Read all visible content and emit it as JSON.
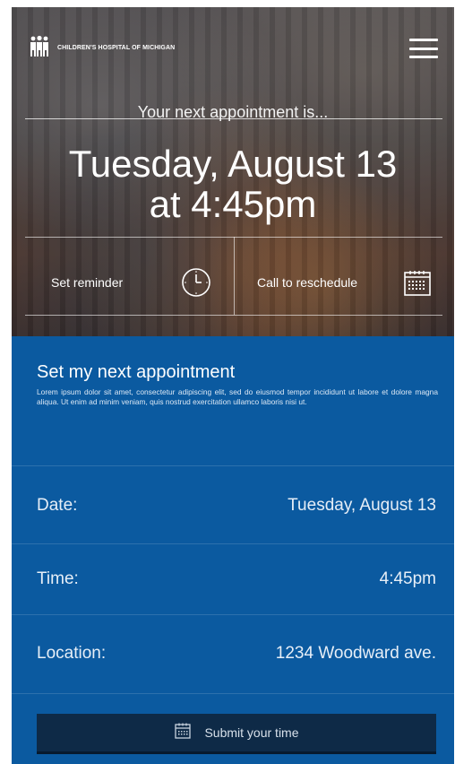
{
  "header": {
    "logo_text": "CHILDREN'S HOSPITAL OF MICHIGAN",
    "logo_icon": "family-icon",
    "menu_icon": "hamburger-menu-icon"
  },
  "hero": {
    "intro": "Your next appointment is...",
    "date": "Tuesday, August 13",
    "time": "at 4:45pm",
    "actions": {
      "reminder_label": "Set reminder",
      "reminder_icon": "clock-icon",
      "reschedule_label": "Call to reschedule",
      "reschedule_icon": "calendar-icon"
    }
  },
  "form": {
    "title": "Set my next appointment",
    "description": "Lorem ipsum dolor sit amet, consectetur adipiscing elit, sed do eiusmod tempor incididunt ut labore et dolore magna aliqua. Ut enim ad minim veniam, quis nostrud exercitation ullamco laboris nisi ut.",
    "fields": [
      {
        "label": "Date:",
        "value": "Tuesday, August 13"
      },
      {
        "label": "Time:",
        "value": "4:45pm"
      },
      {
        "label": "Location:",
        "value": "1234 Woodward ave."
      }
    ],
    "submit_label": "Submit your time",
    "submit_icon": "calendar-icon"
  },
  "colors": {
    "primary_blue": "#0b5aa0",
    "button_navy": "#0e2a47",
    "text_white": "#ffffff"
  }
}
